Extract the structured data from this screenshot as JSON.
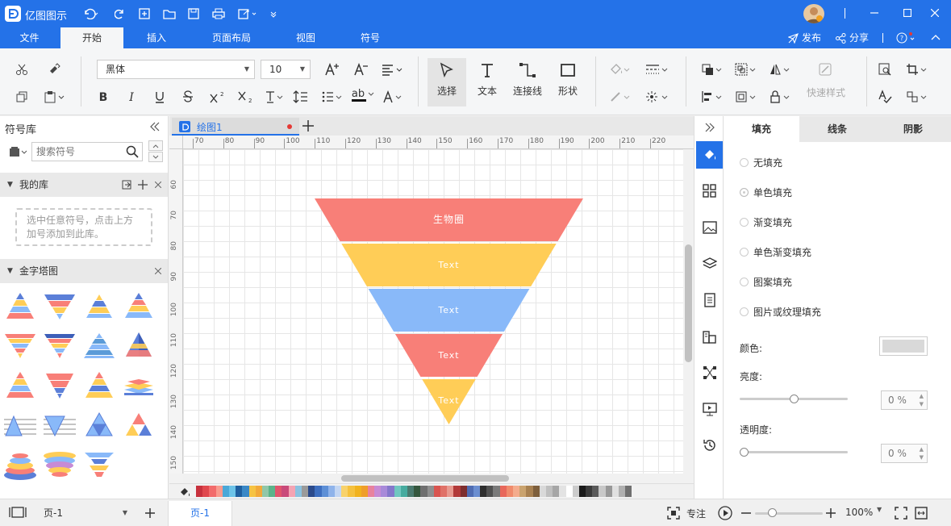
{
  "app": {
    "title": "亿图图示"
  },
  "menu": {
    "items": [
      "文件",
      "开始",
      "插入",
      "页面布局",
      "视图",
      "符号"
    ],
    "active": "开始",
    "publish": "发布",
    "share": "分享"
  },
  "ribbon": {
    "font_name": "黑体",
    "font_size": "10",
    "select_label": "选择",
    "text_label": "文本",
    "connector_label": "连接线",
    "shape_label": "形状",
    "quick_style_label": "快速样式"
  },
  "library": {
    "title": "符号库",
    "search_placeholder": "搜索符号",
    "my_library": "我的库",
    "my_library_hint": "选中任意符号，点击上方加号添加到此库。",
    "pyramid_section": "金字塔图"
  },
  "document": {
    "tab_name": "绘图1",
    "ruler_top": [
      "70",
      "80",
      "90",
      "100",
      "110",
      "120",
      "130",
      "140",
      "150",
      "160",
      "170",
      "180",
      "190",
      "200",
      "210",
      "220"
    ],
    "ruler_left": [
      "60",
      "70",
      "80",
      "90",
      "100",
      "110",
      "120",
      "130",
      "140",
      "150"
    ]
  },
  "diagram": {
    "layers": [
      {
        "label": "生物圈",
        "color": "#f87f78"
      },
      {
        "label": "Text",
        "color": "#ffcd57"
      },
      {
        "label": "Text",
        "color": "#89b9f9"
      },
      {
        "label": "Text",
        "color": "#f87f78"
      },
      {
        "label": "Text",
        "color": "#ffcd57"
      }
    ]
  },
  "right_panel": {
    "tabs": [
      "填充",
      "线条",
      "阴影"
    ],
    "fill_options": [
      "无填充",
      "单色填充",
      "渐变填充",
      "单色渐变填充",
      "图案填充",
      "图片或纹理填充"
    ],
    "selected_option": "单色填充",
    "color_label": "颜色:",
    "brightness_label": "亮度:",
    "brightness_value": "0 %",
    "transparency_label": "透明度:",
    "transparency_value": "0 %"
  },
  "status": {
    "page_select": "页-1",
    "page_tab": "页-1",
    "focus_label": "专注",
    "zoom": "100%"
  },
  "colors": {
    "accent": "#2472e8"
  },
  "palette": [
    "#c7313d",
    "#e0484e",
    "#f26b6b",
    "#f99b8e",
    "#4aa8d8",
    "#6cc3e8",
    "#1f5f9f",
    "#3a88c6",
    "#f6c343",
    "#f2a93b",
    "#91c7a8",
    "#5bb38a",
    "#e1556d",
    "#c94a7a",
    "#f4a4b3",
    "#8cc2e0",
    "#9a9a9a",
    "#2b4a8b",
    "#3d6ebf",
    "#5d8fd6",
    "#8fb3ea",
    "#c3d6f3",
    "#f8d26b",
    "#f5c13e",
    "#f1b21e",
    "#ef9e2a",
    "#e8829e",
    "#c78bd5",
    "#a88ad9",
    "#8578cb",
    "#70c7c0",
    "#46ab9f",
    "#4a7a6f",
    "#35573e",
    "#6f6f6f",
    "#8f8f8f",
    "#d95550",
    "#e07168",
    "#e89a90",
    "#b23a3a",
    "#7d2e2e",
    "#4f6cb2",
    "#6b8ed0",
    "#2d2d2d",
    "#505050",
    "#7a7a7a",
    "#e8675a",
    "#f08b6c",
    "#f4ac8d",
    "#caa36e",
    "#a88151",
    "#7d5f3c",
    "#d9d9d9",
    "#bfbfbf",
    "#a6a6a6",
    "#e3e3e3",
    "#ffffff",
    "#cccccc",
    "#1a1a1a",
    "#3a3a3a",
    "#5a5a5a",
    "#c8c8c8",
    "#989898",
    "#e0e0e0",
    "#b0b0b0",
    "#707070"
  ]
}
